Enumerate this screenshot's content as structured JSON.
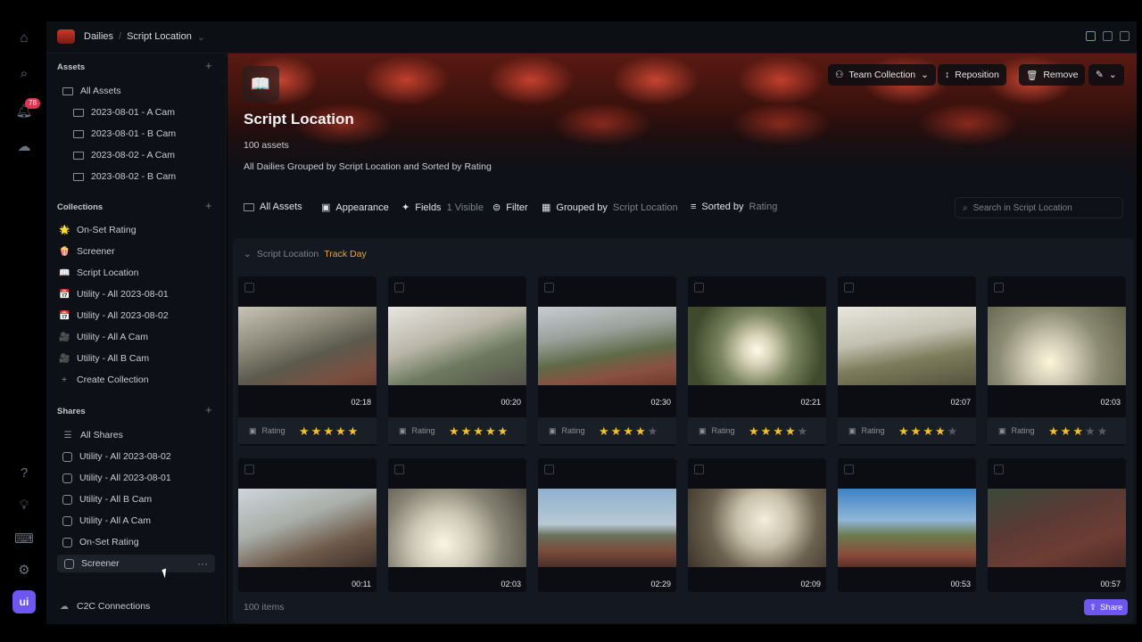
{
  "rail": {
    "notification_count": "78"
  },
  "logo": "ui",
  "topbar": {
    "app": "Dailies",
    "page": "Script Location"
  },
  "sidebar": {
    "assets_header": "Assets",
    "assets": [
      "All Assets",
      "2023-08-01 - A Cam",
      "2023-08-01 - B Cam",
      "2023-08-02 - A Cam",
      "2023-08-02 - B Cam"
    ],
    "collections_header": "Collections",
    "collections": [
      {
        "icon": "🌟",
        "label": "On-Set Rating"
      },
      {
        "icon": "🍿",
        "label": "Screener"
      },
      {
        "icon": "📖",
        "label": "Script Location"
      },
      {
        "icon": "📅",
        "label": "Utility - All 2023-08-01"
      },
      {
        "icon": "📅",
        "label": "Utility - All 2023-08-02"
      },
      {
        "icon": "🎥",
        "label": "Utility - All A Cam"
      },
      {
        "icon": "🎥",
        "label": "Utility - All B Cam"
      },
      {
        "icon": "+",
        "label": "Create Collection"
      }
    ],
    "shares_header": "Shares",
    "shares": [
      "All Shares",
      "Utility - All 2023-08-02",
      "Utility - All 2023-08-01",
      "Utility - All B Cam",
      "Utility - All A Cam",
      "On-Set Rating",
      "Screener"
    ],
    "c2c": "C2C Connections"
  },
  "banner": {
    "icon": "📖",
    "title": "Script Location",
    "count": "100 assets",
    "description": "All Dailies Grouped by Script Location and Sorted by Rating",
    "team_collection": "Team Collection",
    "reposition": "Reposition",
    "remove": "Remove"
  },
  "toolbar": {
    "all_assets": "All Assets",
    "appearance": "Appearance",
    "fields": "Fields",
    "fields_count": "1 Visible",
    "filter": "Filter",
    "grouped_by": "Grouped by",
    "grouped_value": "Script Location",
    "sorted_by": "Sorted by",
    "sorted_value": "Rating",
    "search_placeholder": "Search in Script Location"
  },
  "group": {
    "field": "Script Location",
    "value": "Track Day"
  },
  "rating_label": "Rating",
  "row1": [
    {
      "duration": "02:18",
      "rating": 5
    },
    {
      "duration": "00:20",
      "rating": 5
    },
    {
      "duration": "02:30",
      "rating": 4
    },
    {
      "duration": "02:21",
      "rating": 4
    },
    {
      "duration": "02:07",
      "rating": 4
    },
    {
      "duration": "02:03",
      "rating": 3
    }
  ],
  "row2": [
    {
      "duration": "00:11"
    },
    {
      "duration": "02:03"
    },
    {
      "duration": "02:29"
    },
    {
      "duration": "02:09"
    },
    {
      "duration": "00:53"
    },
    {
      "duration": "00:57"
    }
  ],
  "footer": {
    "items": "100 items",
    "share": "Share"
  }
}
